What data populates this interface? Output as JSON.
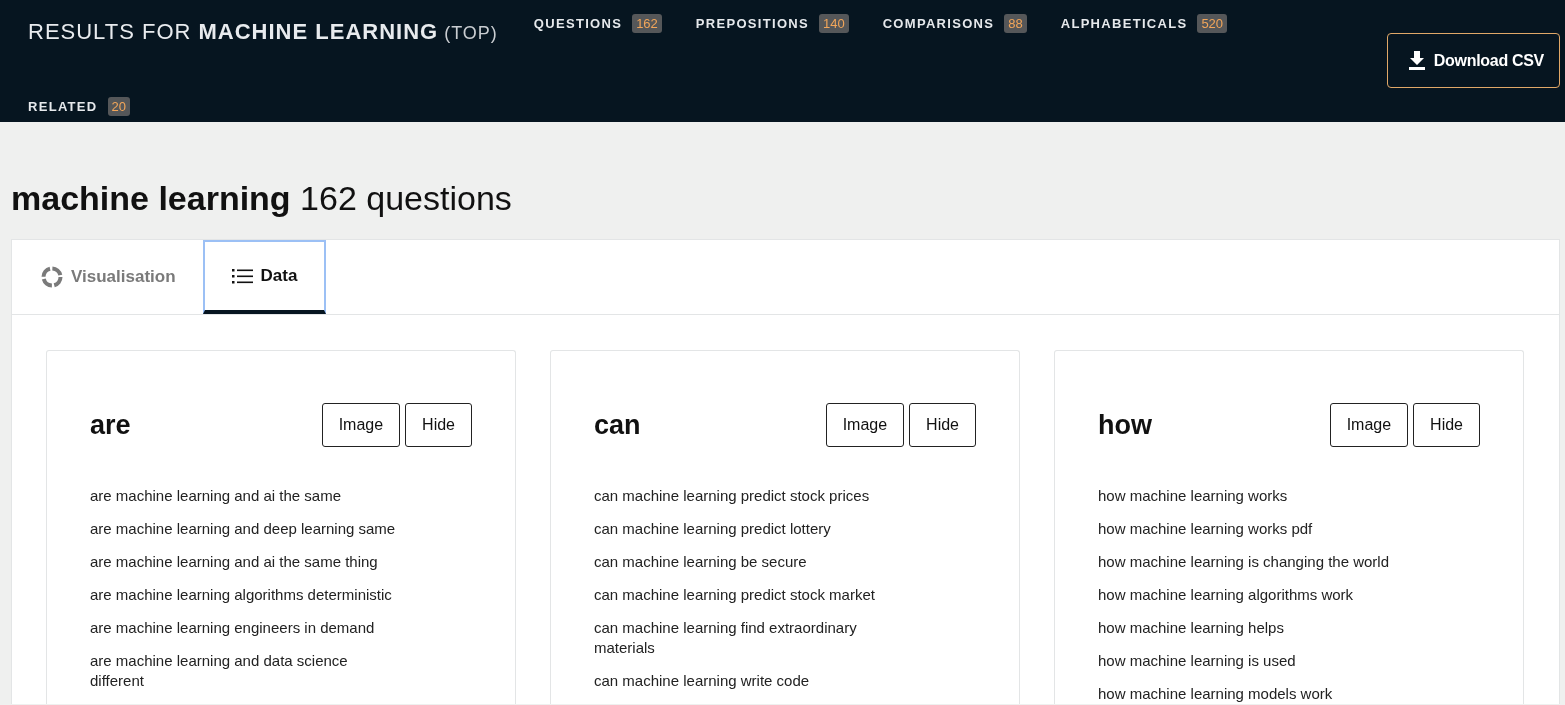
{
  "header": {
    "title_prefix": "RESULTS FOR",
    "title_query": "MACHINE LEARNING",
    "title_suffix": "(TOP)",
    "nav": [
      {
        "label": "QUESTIONS",
        "count": "162"
      },
      {
        "label": "PREPOSITIONS",
        "count": "140"
      },
      {
        "label": "COMPARISONS",
        "count": "88"
      },
      {
        "label": "ALPHABETICALS",
        "count": "520"
      },
      {
        "label": "RELATED",
        "count": "20"
      }
    ],
    "download_button": "Download CSV"
  },
  "heading": {
    "query": "machine learning",
    "count_text": "162 questions"
  },
  "tabs": [
    {
      "label": "Visualisation",
      "kind": "visualisation",
      "selected": false
    },
    {
      "label": "Data",
      "kind": "data",
      "selected": true
    }
  ],
  "cards": [
    {
      "title": "are",
      "buttons": [
        "Image",
        "Hide"
      ],
      "items": [
        "are machine learning and ai the same",
        "are machine learning and deep learning same",
        "are machine learning and ai the same thing",
        "are machine learning algorithms deterministic",
        "are machine learning engineers in demand",
        "are machine learning and data science different"
      ]
    },
    {
      "title": "can",
      "buttons": [
        "Image",
        "Hide"
      ],
      "items": [
        "can machine learning predict stock prices",
        "can machine learning predict lottery",
        "can machine learning be secure",
        "can machine learning predict stock market",
        "can machine learning find extraordinary materials",
        "can machine learning write code"
      ]
    },
    {
      "title": "how",
      "buttons": [
        "Image",
        "Hide"
      ],
      "items": [
        "how machine learning works",
        "how machine learning works pdf",
        "how machine learning is changing the world",
        "how machine learning algorithms work",
        "how machine learning helps",
        "how machine learning is used",
        "how machine learning models work"
      ]
    }
  ]
}
